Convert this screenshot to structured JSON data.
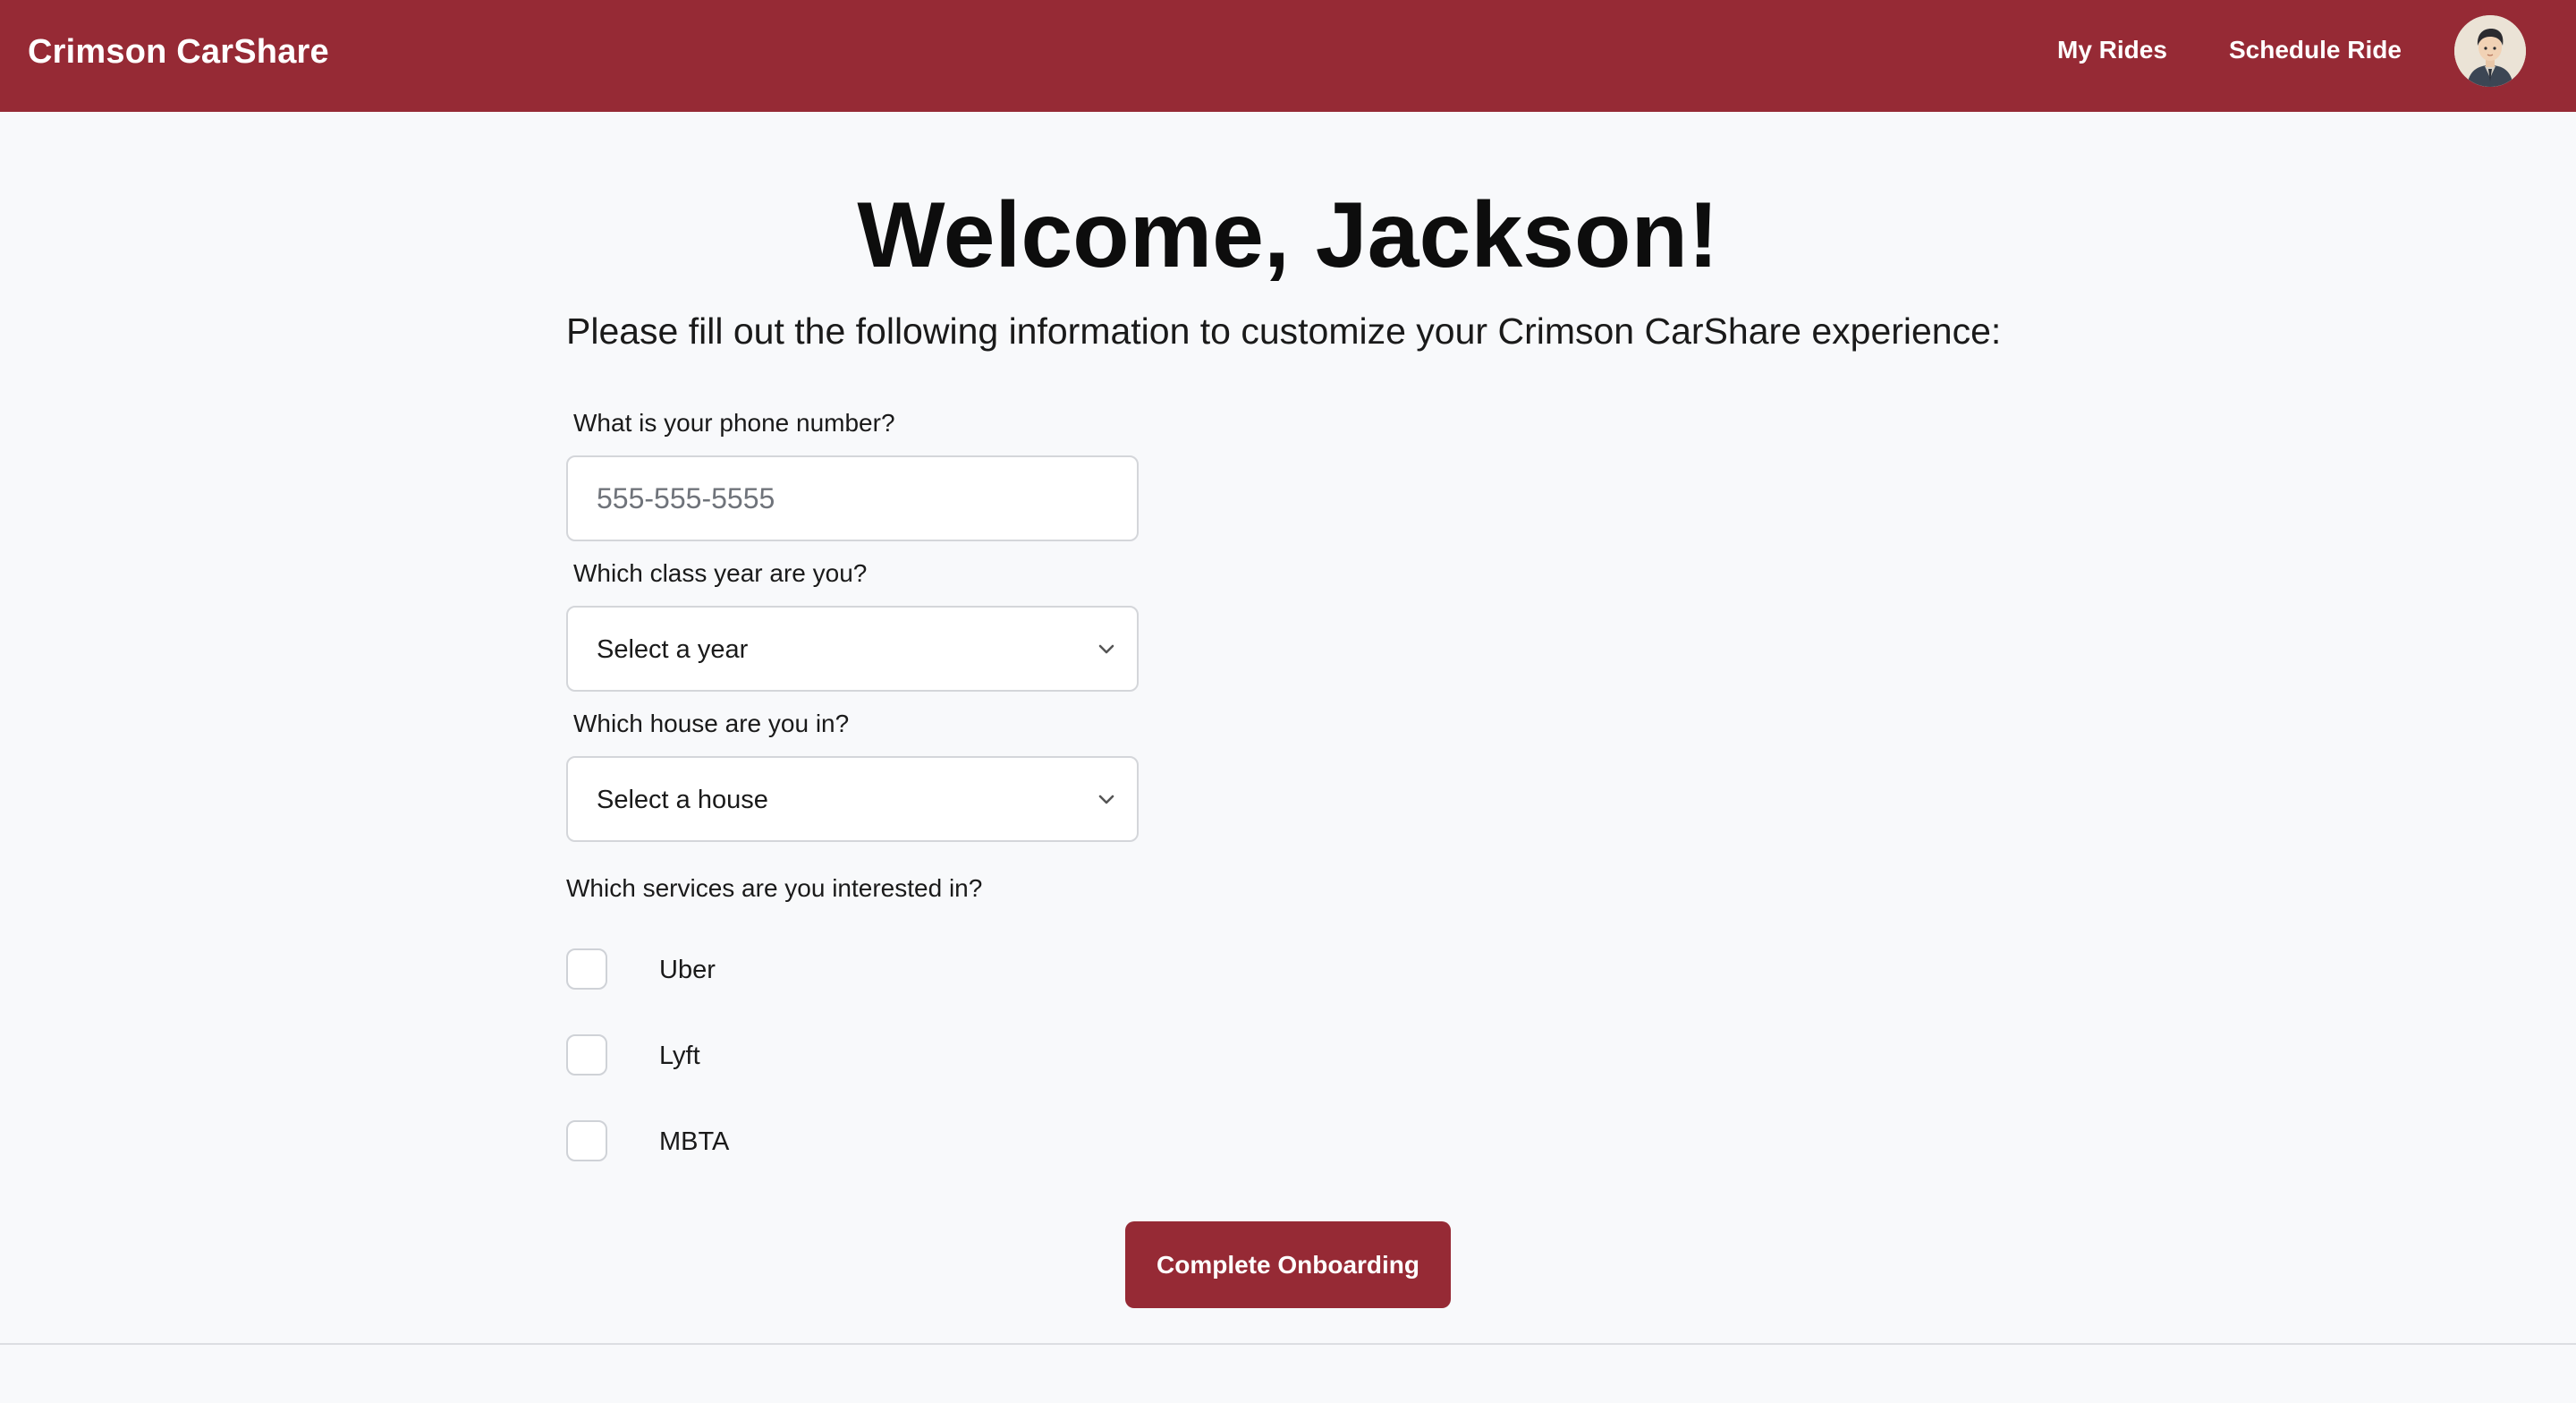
{
  "navbar": {
    "brand": "Crimson CarShare",
    "links": [
      {
        "label": "My Rides"
      },
      {
        "label": "Schedule Ride"
      }
    ],
    "avatar_icon": "user-avatar-icon",
    "background_color": "#962a35"
  },
  "main": {
    "title": "Welcome, Jackson!",
    "intro": "Please fill out the following information to customize your Crimson CarShare experience:",
    "phone": {
      "label": "What is your phone number?",
      "placeholder": "555-555-5555",
      "value": ""
    },
    "class_year": {
      "label": "Which class year are you?",
      "selected": "Select a year"
    },
    "house": {
      "label": "Which house are you in?",
      "selected": "Select a house"
    },
    "services": {
      "label": "Which services are you interested in?",
      "options": [
        {
          "label": "Uber",
          "checked": false
        },
        {
          "label": "Lyft",
          "checked": false
        },
        {
          "label": "MBTA",
          "checked": false
        }
      ]
    },
    "submit_label": "Complete Onboarding"
  },
  "colors": {
    "accent": "#962a35",
    "page_background": "#f8f9fb"
  }
}
